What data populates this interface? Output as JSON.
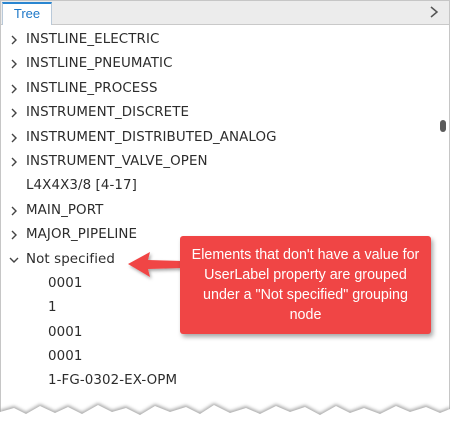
{
  "tab": {
    "label": "Tree"
  },
  "tree": {
    "items": [
      {
        "label": "INSTLINE_ELECTRIC",
        "expanded": false
      },
      {
        "label": "INSTLINE_PNEUMATIC",
        "expanded": false
      },
      {
        "label": "INSTLINE_PROCESS",
        "expanded": false
      },
      {
        "label": "INSTRUMENT_DISCRETE",
        "expanded": false
      },
      {
        "label": "INSTRUMENT_DISTRIBUTED_ANALOG",
        "expanded": false
      },
      {
        "label": "INSTRUMENT_VALVE_OPEN",
        "expanded": false
      },
      {
        "label": "L4X4X3/8 [4-17]"
      },
      {
        "label": "MAIN_PORT",
        "expanded": false
      },
      {
        "label": "MAJOR_PIPELINE",
        "expanded": false
      },
      {
        "label": "Not specified",
        "expanded": true
      },
      {
        "label": "0001"
      },
      {
        "label": "1"
      },
      {
        "label": "0001"
      },
      {
        "label": "0001"
      },
      {
        "label": "1-FG-0302-EX-OPM"
      }
    ]
  },
  "callout": {
    "text": "Elements that don't have a value for UserLabel property are grouped under a \"Not specified\" grouping node"
  },
  "colors": {
    "accent": "#2a86d1",
    "callout": "#f04545"
  }
}
